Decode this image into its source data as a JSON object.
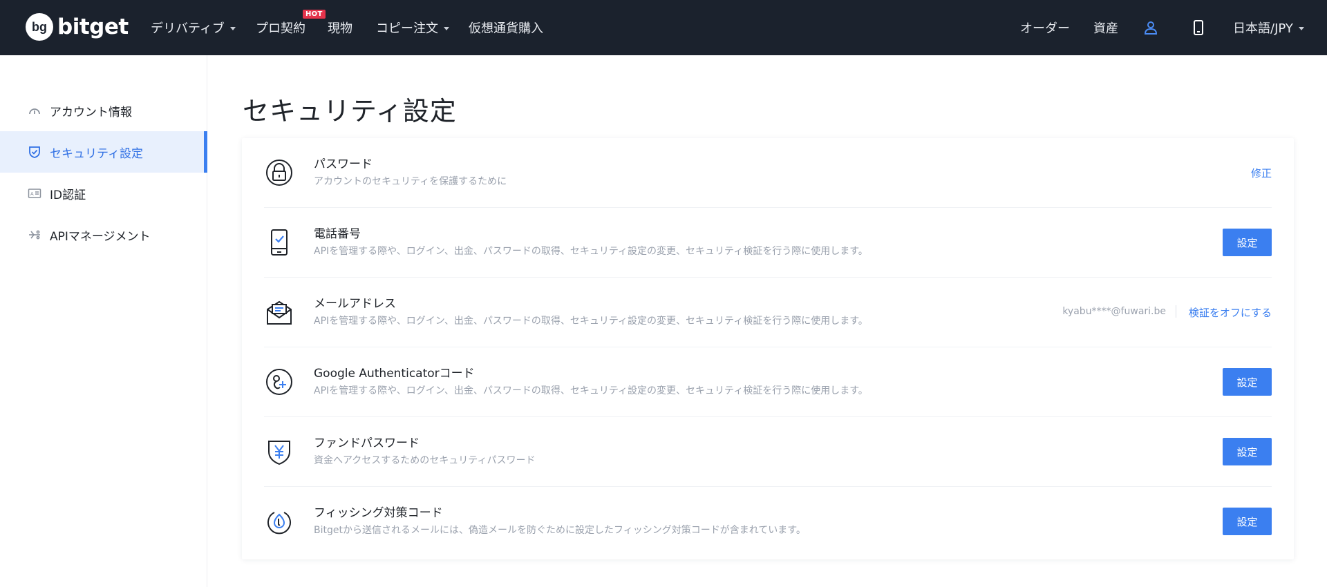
{
  "brand": {
    "name": "bitget",
    "mark": "bg"
  },
  "nav": {
    "items": [
      {
        "label": "デリバティブ",
        "has_caret": true
      },
      {
        "label": "プロ契約",
        "badge": "HOT"
      },
      {
        "label": "現物"
      },
      {
        "label": "コピー注文",
        "has_caret": true
      },
      {
        "label": "仮想通貨購入"
      }
    ],
    "right": {
      "orders": "オーダー",
      "assets": "資産",
      "language": "日本語/JPY",
      "user_icon": "user-icon",
      "phone_icon": "mobile-icon"
    }
  },
  "sidebar": {
    "items": [
      {
        "label": "アカウント情報",
        "icon": "dashboard-icon",
        "active": false
      },
      {
        "label": "セキュリティ設定",
        "icon": "shield-check-icon",
        "active": true
      },
      {
        "label": "ID認証",
        "icon": "id-card-icon",
        "active": false
      },
      {
        "label": "APIマネージメント",
        "icon": "api-icon",
        "active": false
      }
    ]
  },
  "page": {
    "title": "セキュリティ設定"
  },
  "security": {
    "rows": [
      {
        "title": "パスワード",
        "desc": "アカウントのセキュリティを保護するために",
        "icon": "lock-icon",
        "action": "修正"
      },
      {
        "title": "電話番号",
        "desc": "APIを管理する際や、ログイン、出金、パスワードの取得、セキュリティ設定の変更、セキュリティ検証を行う際に使用します。",
        "icon": "phone-check-icon",
        "action": "設定"
      },
      {
        "title": "メールアドレス",
        "desc": "APIを管理する際や、ログイン、出金、パスワードの取得、セキュリティ設定の変更、セキュリティ検証を行う際に使用します。",
        "icon": "mail-icon",
        "value": "kyabu****@fuwari.be",
        "action": "検証をオフにする"
      },
      {
        "title": "Google Authenticatorコード",
        "desc": "APIを管理する際や、ログイン、出金、パスワードの取得、セキュリティ設定の変更、セキュリティ検証を行う際に使用します。",
        "icon": "google-auth-icon",
        "action": "設定"
      },
      {
        "title": "ファンドパスワード",
        "desc": "資金へアクセスするためのセキュリティパスワード",
        "icon": "yen-shield-icon",
        "action": "設定"
      },
      {
        "title": "フィッシング対策コード",
        "desc": "Bitgetから送信されるメールには、偽造メールを防ぐために設定したフィッシング対策コードが含まれています。",
        "icon": "anti-phishing-icon",
        "action": "設定"
      }
    ]
  },
  "colors": {
    "accent": "#3b7ff0",
    "header_bg": "#1b222d",
    "hot_badge": "#e5334b",
    "active_bg": "#e8f0fd"
  }
}
